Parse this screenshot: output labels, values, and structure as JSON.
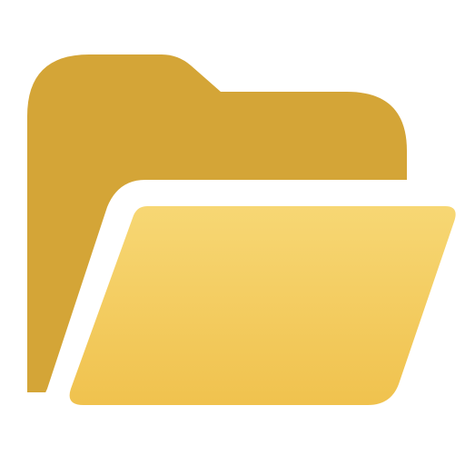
{
  "icon": {
    "name": "open-folder-icon",
    "colors": {
      "back": "#D4A537",
      "front_top": "#F7D774",
      "front_bottom": "#F0C24E",
      "outline": "#FFFFFF",
      "background": "#FFFFFF"
    }
  }
}
